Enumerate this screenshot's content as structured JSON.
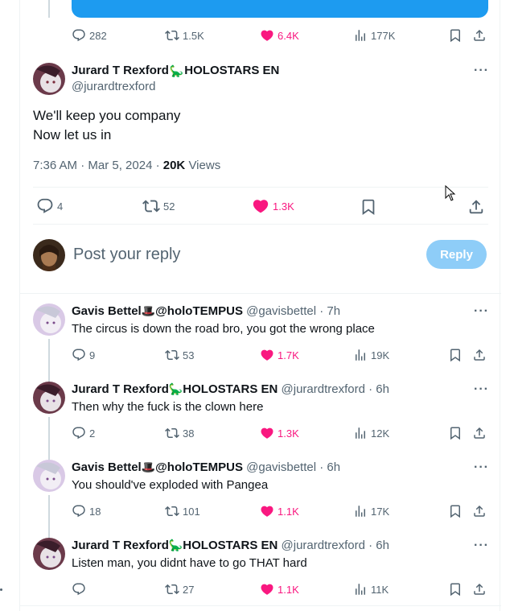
{
  "top_tweet": {
    "stats": {
      "replies": "282",
      "retweets": "1.5K",
      "likes": "6.4K",
      "views": "177K"
    }
  },
  "main_tweet": {
    "author_name": "Jurard T Rexford",
    "author_emoji": "🦕",
    "author_suffix": "HOLOSTARS EN",
    "handle": "@jurardtrexford",
    "text_line1": "We'll keep you company",
    "text_line2": "Now let us in",
    "timestamp": "7:36 AM · Mar 5, 2024 · ",
    "views_count": "20K",
    "views_label": " Views",
    "stats": {
      "replies": "4",
      "retweets": "52",
      "likes": "1.3K"
    }
  },
  "composer": {
    "placeholder": "Post your reply",
    "reply_button": "Reply"
  },
  "replies": [
    {
      "name": "Gavis Bettel",
      "emoji": "🎩",
      "name_suffix": "@holoTEMPUS",
      "handle_time": " @gavisbettel · 7h",
      "text": "The circus is down the road bro, you got the wrong place",
      "replies": "9",
      "retweets": "53",
      "likes": "1.7K",
      "views": "19K"
    },
    {
      "name": "Jurard T Rexford",
      "emoji": "🦕",
      "name_suffix": "HOLOSTARS EN",
      "handle_time": " @jurardtrexford · 6h",
      "text": "Then why the fuck is the clown here",
      "replies": "2",
      "retweets": "38",
      "likes": "1.3K",
      "views": "12K"
    },
    {
      "name": "Gavis Bettel",
      "emoji": "🎩",
      "name_suffix": "@holoTEMPUS",
      "handle_time": " @gavisbettel · 6h",
      "text": "You should've exploded with Pangea",
      "replies": "18",
      "retweets": "101",
      "likes": "1.1K",
      "views": "17K"
    },
    {
      "name": "Jurard T Rexford",
      "emoji": "🦕",
      "name_suffix": "HOLOSTARS EN",
      "handle_time": " @jurardtrexford · 6h",
      "text": "Listen man, you didnt have to go THAT hard",
      "replies": "",
      "retweets": "27",
      "likes": "1.1K",
      "views": "11K"
    }
  ],
  "colors": {
    "accent": "#1d9bf0",
    "like": "#f91880",
    "muted": "#536471"
  },
  "icons": [
    "reply-icon",
    "retweet-icon",
    "heart-icon",
    "views-icon",
    "bookmark-icon",
    "share-icon",
    "more-icon"
  ]
}
